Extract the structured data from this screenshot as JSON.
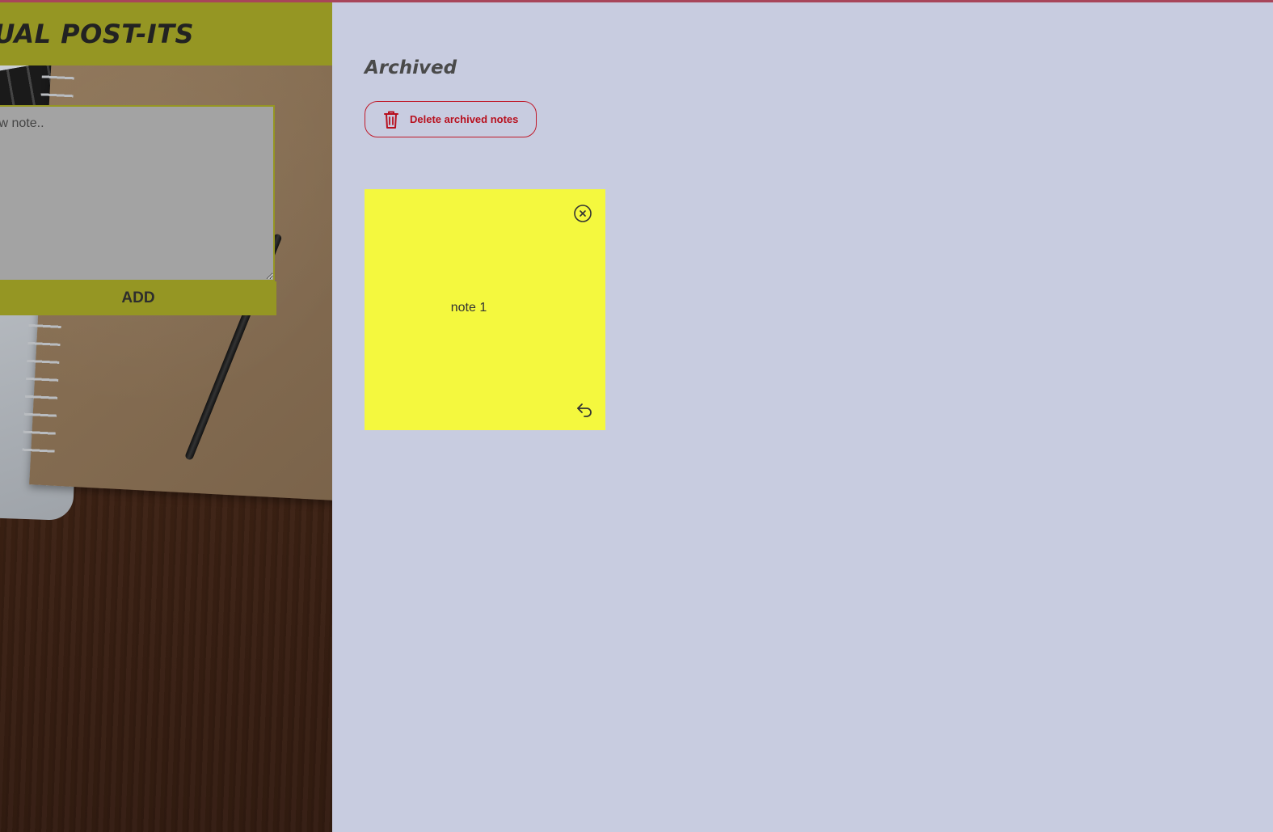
{
  "app": {
    "title": "TUAL POST-ITS"
  },
  "new_note": {
    "placeholder": "e a new note..",
    "add_label": "ADD"
  },
  "archived": {
    "heading": "Archived",
    "delete_label": "Delete archived notes",
    "delete_icon": "trash-icon",
    "notes": [
      {
        "text": "note 1",
        "color": "#f4f83e",
        "close_icon": "close-circle-icon",
        "restore_icon": "undo-arrow-icon"
      }
    ]
  },
  "colors": {
    "header_bar": "#959623",
    "page_background": "#c8cce0",
    "accent_red": "#b8101e",
    "note_yellow": "#f4f83e",
    "input_gray": "#a3a3a3"
  }
}
